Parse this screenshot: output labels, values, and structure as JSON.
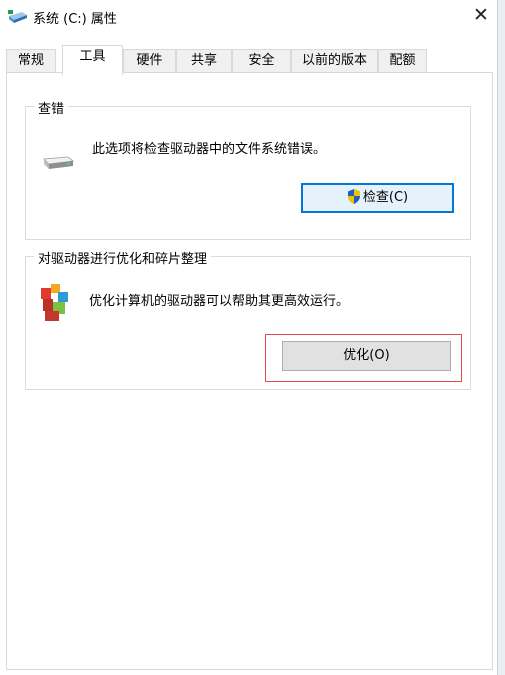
{
  "window": {
    "title": "系统 (C:) 属性",
    "close_glyph": "✕",
    "icons": {
      "title": "drive-icon",
      "close": "close-icon"
    }
  },
  "tabs": [
    {
      "label": "常规",
      "active": false
    },
    {
      "label": "工具",
      "active": true
    },
    {
      "label": "硬件",
      "active": false
    },
    {
      "label": "共享",
      "active": false
    },
    {
      "label": "安全",
      "active": false
    },
    {
      "label": "以前的版本",
      "active": false
    },
    {
      "label": "配额",
      "active": false
    }
  ],
  "error_check": {
    "title": "查错",
    "description": "此选项将检查驱动器中的文件系统错误。",
    "button_label": "检查(C)",
    "icon": "drive-icon",
    "button_icon": "uac-shield-icon"
  },
  "optimize": {
    "title": "对驱动器进行优化和碎片整理",
    "description": "优化计算机的驱动器可以帮助其更高效运行。",
    "button_label": "优化(O)",
    "icon": "defrag-icon"
  },
  "colors": {
    "focus_border": "#0078d7",
    "highlight_box": "#e14b4b",
    "button_face": "#e1e1e1"
  }
}
